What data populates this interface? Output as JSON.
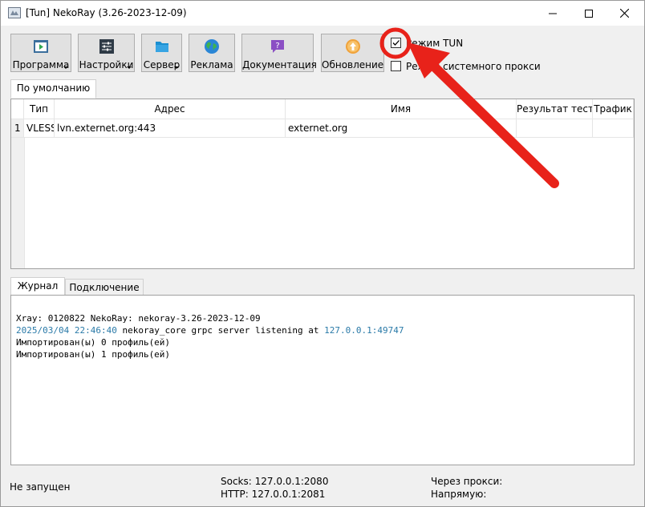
{
  "window": {
    "title": "[Tun] NekoRay (3.26-2023-12-09)"
  },
  "toolbar": {
    "program": "Программа",
    "settings": "Настройки",
    "server": "Сервер",
    "ads": "Реклама",
    "docs": "Документация",
    "update": "Обновление"
  },
  "options": {
    "tun_mode_label": "Режим TUN",
    "tun_mode_checked": true,
    "system_proxy_label": "Режим системного прокси",
    "system_proxy_checked": false
  },
  "groups": {
    "tabs": [
      "По умолчанию"
    ]
  },
  "table": {
    "columns": [
      "Тип",
      "Адрес",
      "Имя",
      "Результат теста",
      "Трафик"
    ],
    "rows": [
      {
        "num": "1",
        "type": "VLESS",
        "address": "lvn.externet.org:443",
        "name": "externet.org",
        "test": "",
        "traffic": ""
      }
    ]
  },
  "bottom_tabs": [
    "Журнал",
    "Подключение"
  ],
  "log": {
    "lines": [
      "Xray: 0120822 NekoRay: nekoray-3.26-2023-12-09",
      "2025/03/04 22:46:40 nekoray_core grpc server listening at 127.0.0.1:49747",
      "Импортирован(ы) 0 профиль(ей)",
      "Импортирован(ы) 1 профиль(ей)"
    ],
    "timestamp": "2025/03/04 22:46:40",
    "message_mid": " nekoray_core grpc server listening at ",
    "address": "127.0.0.1:49747"
  },
  "status": {
    "state": "Не запущен",
    "socks": "Socks: 127.0.0.1:2080",
    "http": "HTTP: 127.0.0.1:2081",
    "via_proxy": "Через прокси:",
    "direct": "Напрямую:"
  },
  "colors": {
    "annotation_red": "#e8221a",
    "log_blue": "#2a7aa8",
    "titlebar_bg": "#ffffff",
    "window_bg": "#f0f0f0"
  }
}
